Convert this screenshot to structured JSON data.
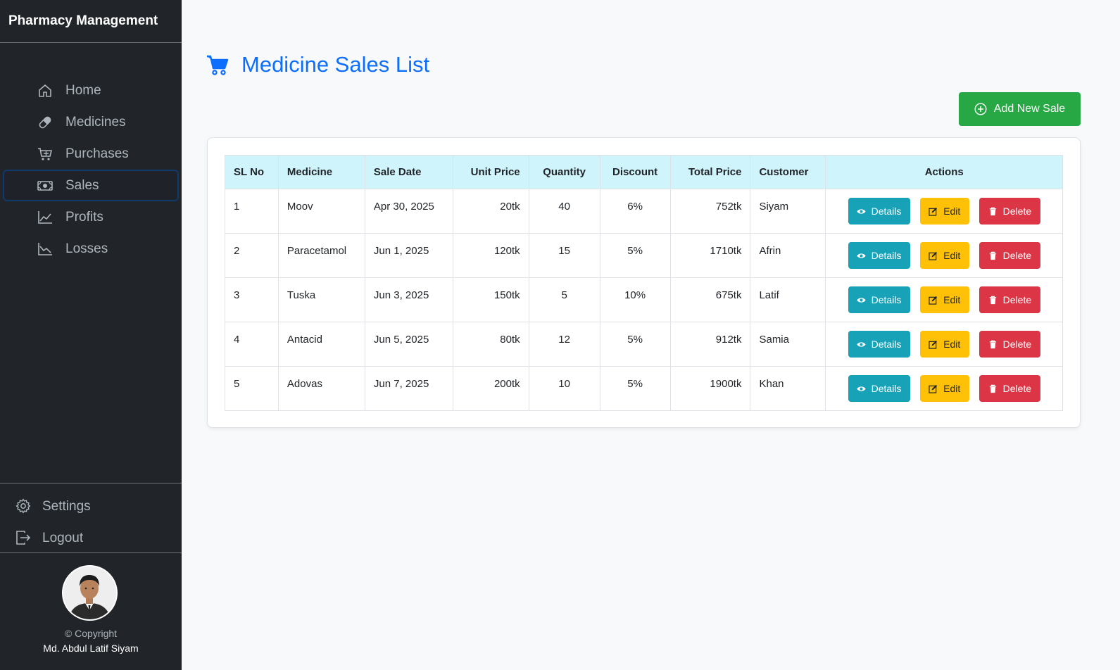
{
  "sidebar": {
    "brand": "Pharmacy Management",
    "nav": [
      {
        "label": "Home",
        "icon": "home-icon",
        "active": false
      },
      {
        "label": "Medicines",
        "icon": "capsule-icon",
        "active": false
      },
      {
        "label": "Purchases",
        "icon": "cart-icon",
        "active": false
      },
      {
        "label": "Sales",
        "icon": "cash-icon",
        "active": true
      },
      {
        "label": "Profits",
        "icon": "chart-line-icon",
        "active": false
      },
      {
        "label": "Losses",
        "icon": "chart-down-icon",
        "active": false
      }
    ],
    "settings_label": "Settings",
    "logout_label": "Logout",
    "copyright": "© Copyright",
    "author": "Md. Abdul Latif Siyam"
  },
  "main": {
    "title": "Medicine Sales List",
    "add_button": "Add New Sale",
    "columns": [
      "SL No",
      "Medicine",
      "Sale Date",
      "Unit Price",
      "Quantity",
      "Discount",
      "Total Price",
      "Customer",
      "Actions"
    ],
    "rows": [
      {
        "sl": "1",
        "medicine": "Moov",
        "date": "Apr 30, 2025",
        "unit_price": "20tk",
        "quantity": "40",
        "discount": "6%",
        "total": "752tk",
        "customer": "Siyam"
      },
      {
        "sl": "2",
        "medicine": "Paracetamol",
        "date": "Jun 1, 2025",
        "unit_price": "120tk",
        "quantity": "15",
        "discount": "5%",
        "total": "1710tk",
        "customer": "Afrin"
      },
      {
        "sl": "3",
        "medicine": "Tuska",
        "date": "Jun 3, 2025",
        "unit_price": "150tk",
        "quantity": "5",
        "discount": "10%",
        "total": "675tk",
        "customer": "Latif"
      },
      {
        "sl": "4",
        "medicine": "Antacid",
        "date": "Jun 5, 2025",
        "unit_price": "80tk",
        "quantity": "12",
        "discount": "5%",
        "total": "912tk",
        "customer": "Samia"
      },
      {
        "sl": "5",
        "medicine": "Adovas",
        "date": "Jun 7, 2025",
        "unit_price": "200tk",
        "quantity": "10",
        "discount": "5%",
        "total": "1900tk",
        "customer": "Khan"
      }
    ],
    "actions": {
      "details": "Details",
      "edit": "Edit",
      "delete": "Delete"
    }
  },
  "colors": {
    "sidebar_bg": "#212529",
    "primary": "#0d6efd",
    "success": "#28a745",
    "info": "#17a2b8",
    "warning": "#ffc107",
    "danger": "#dc3545",
    "table_header": "#cff4fc"
  }
}
